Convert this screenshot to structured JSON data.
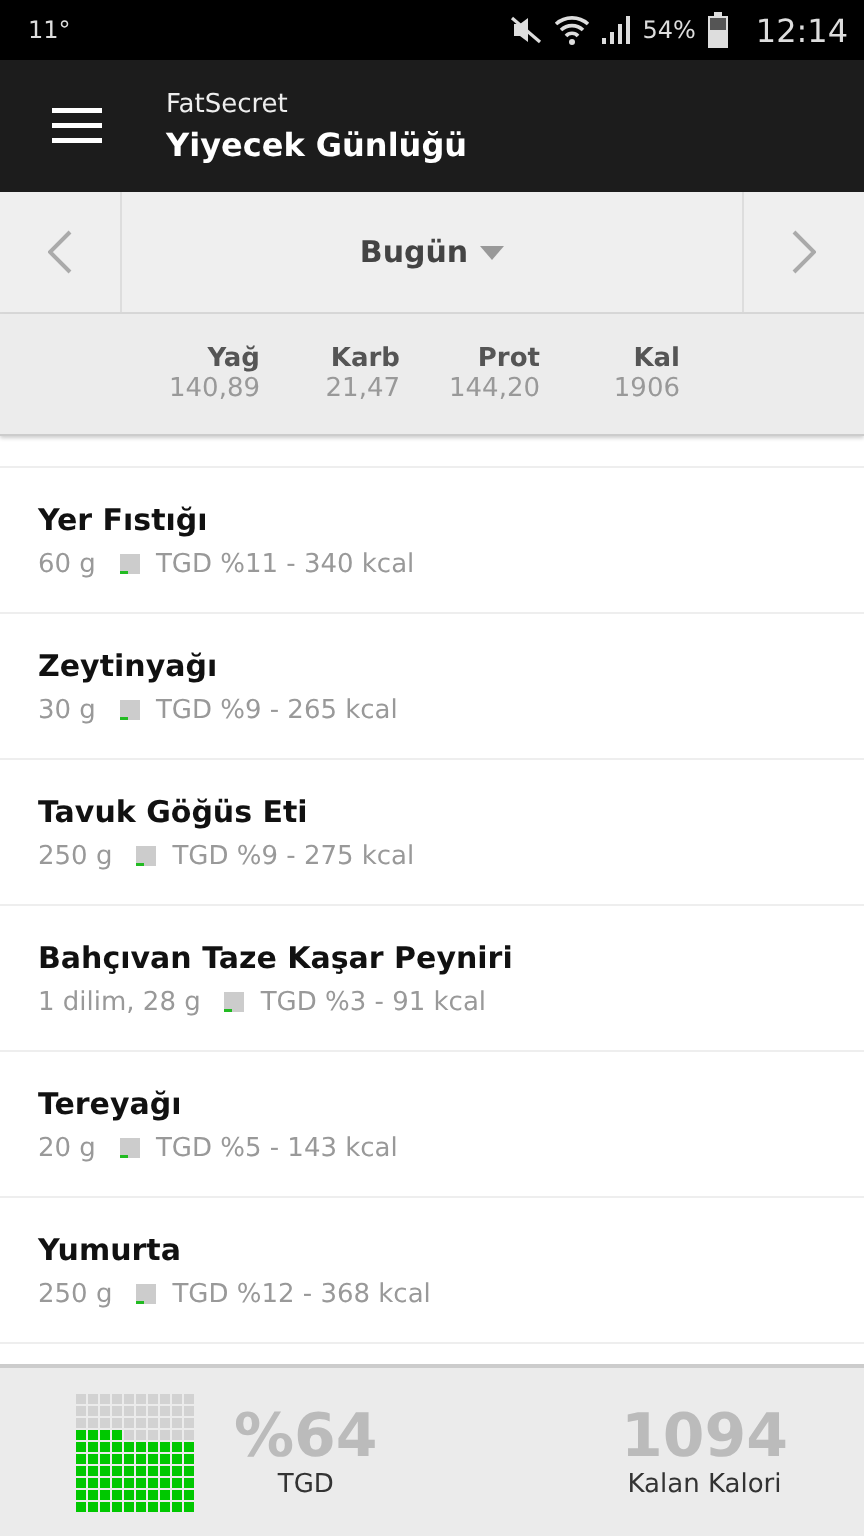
{
  "status_bar": {
    "temperature": "11°",
    "battery_text": "54%",
    "time": "12:14"
  },
  "app_bar": {
    "app_name": "FatSecret",
    "title": "Yiyecek Günlüğü"
  },
  "date_nav": {
    "label": "Bugün"
  },
  "totals": [
    {
      "label": "Yağ",
      "value": "140,89"
    },
    {
      "label": "Karb",
      "value": "21,47"
    },
    {
      "label": "Prot",
      "value": "144,20"
    },
    {
      "label": "Kal",
      "value": "1906"
    }
  ],
  "foods": [
    {
      "name": "Yer Fıstığı",
      "amount": "60  g",
      "rdi": "TGD %11 - 340 kcal"
    },
    {
      "name": "Zeytinyağı",
      "amount": "30 g",
      "rdi": "TGD %9 - 265 kcal"
    },
    {
      "name": "Tavuk Göğüs Eti",
      "amount": "250 g",
      "rdi": "TGD %9 - 275 kcal"
    },
    {
      "name": "Bahçıvan Taze Kaşar Peyniri",
      "amount": "1 dilim, 28 g",
      "rdi": "TGD %3 - 91 kcal"
    },
    {
      "name": "Tereyağı",
      "amount": "20 g",
      "rdi": "TGD %5 - 143 kcal"
    },
    {
      "name": "Yumurta",
      "amount": "250 g",
      "rdi": "TGD %12 - 368 kcal"
    }
  ],
  "summary": {
    "percent": "%64",
    "percent_label": "TGD",
    "remaining": "1094",
    "remaining_label": "Kalan Kalori"
  }
}
